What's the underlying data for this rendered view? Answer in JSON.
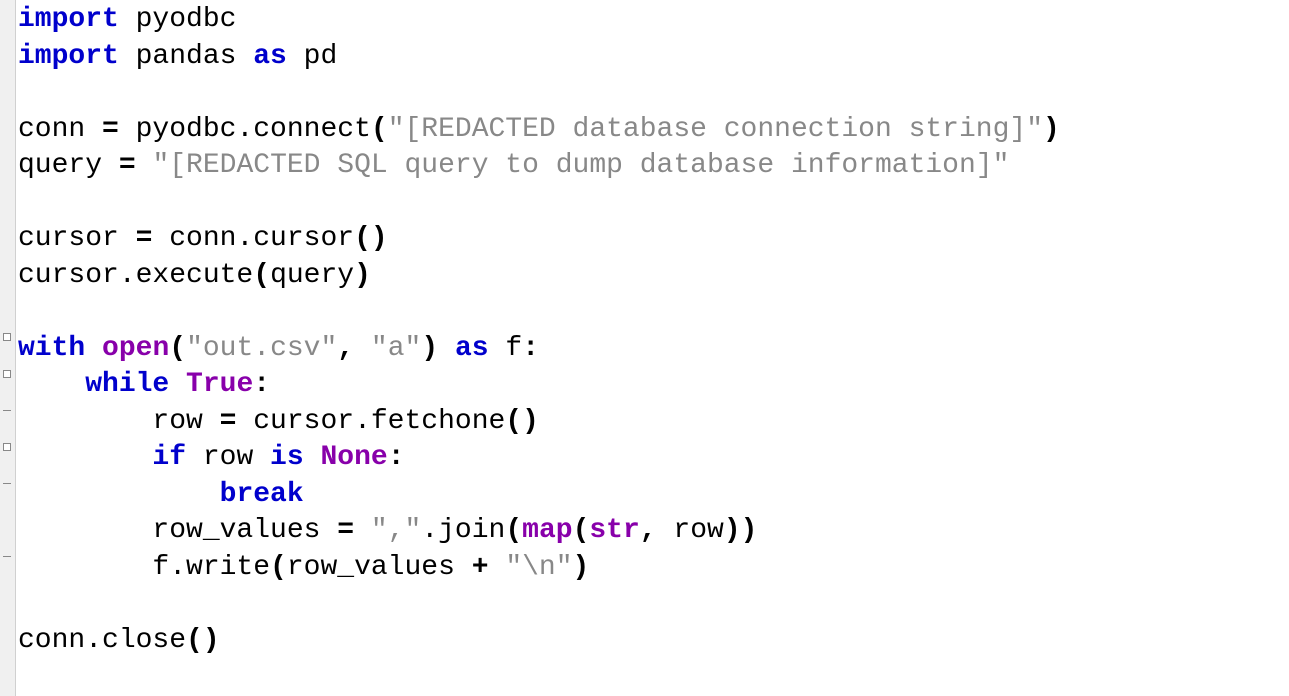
{
  "code": {
    "lines": [
      {
        "segments": [
          {
            "cls": "kw",
            "text": "import"
          },
          {
            "cls": "id",
            "text": " pyodbc"
          }
        ]
      },
      {
        "segments": [
          {
            "cls": "kw",
            "text": "import"
          },
          {
            "cls": "id",
            "text": " pandas "
          },
          {
            "cls": "kw",
            "text": "as"
          },
          {
            "cls": "id",
            "text": " pd"
          }
        ]
      },
      {
        "segments": [
          {
            "cls": "id",
            "text": ""
          }
        ]
      },
      {
        "segments": [
          {
            "cls": "id",
            "text": "conn "
          },
          {
            "cls": "op",
            "text": "="
          },
          {
            "cls": "id",
            "text": " pyodbc.connect"
          },
          {
            "cls": "punc",
            "text": "("
          },
          {
            "cls": "str",
            "text": "\"[REDACTED database connection string]\""
          },
          {
            "cls": "punc",
            "text": ")"
          }
        ]
      },
      {
        "segments": [
          {
            "cls": "id",
            "text": "query "
          },
          {
            "cls": "op",
            "text": "="
          },
          {
            "cls": "id",
            "text": " "
          },
          {
            "cls": "str",
            "text": "\"[REDACTED SQL query to dump database information]\""
          }
        ]
      },
      {
        "segments": [
          {
            "cls": "id",
            "text": ""
          }
        ]
      },
      {
        "segments": [
          {
            "cls": "id",
            "text": "cursor "
          },
          {
            "cls": "op",
            "text": "="
          },
          {
            "cls": "id",
            "text": " conn.cursor"
          },
          {
            "cls": "punc",
            "text": "()"
          }
        ]
      },
      {
        "segments": [
          {
            "cls": "id",
            "text": "cursor.execute"
          },
          {
            "cls": "punc",
            "text": "("
          },
          {
            "cls": "id",
            "text": "query"
          },
          {
            "cls": "punc",
            "text": ")"
          }
        ]
      },
      {
        "segments": [
          {
            "cls": "id",
            "text": ""
          }
        ]
      },
      {
        "segments": [
          {
            "cls": "kw",
            "text": "with"
          },
          {
            "cls": "id",
            "text": " "
          },
          {
            "cls": "kw2",
            "text": "open"
          },
          {
            "cls": "punc",
            "text": "("
          },
          {
            "cls": "str",
            "text": "\"out.csv\""
          },
          {
            "cls": "punc",
            "text": ","
          },
          {
            "cls": "id",
            "text": " "
          },
          {
            "cls": "str",
            "text": "\"a\""
          },
          {
            "cls": "punc",
            "text": ")"
          },
          {
            "cls": "id",
            "text": " "
          },
          {
            "cls": "kw",
            "text": "as"
          },
          {
            "cls": "id",
            "text": " f"
          },
          {
            "cls": "punc",
            "text": ":"
          }
        ]
      },
      {
        "segments": [
          {
            "cls": "id",
            "text": "    "
          },
          {
            "cls": "kw",
            "text": "while"
          },
          {
            "cls": "id",
            "text": " "
          },
          {
            "cls": "kw2",
            "text": "True"
          },
          {
            "cls": "punc",
            "text": ":"
          }
        ]
      },
      {
        "segments": [
          {
            "cls": "id",
            "text": "        row "
          },
          {
            "cls": "op",
            "text": "="
          },
          {
            "cls": "id",
            "text": " cursor.fetchone"
          },
          {
            "cls": "punc",
            "text": "()"
          }
        ]
      },
      {
        "segments": [
          {
            "cls": "id",
            "text": "        "
          },
          {
            "cls": "kw",
            "text": "if"
          },
          {
            "cls": "id",
            "text": " row "
          },
          {
            "cls": "kw",
            "text": "is"
          },
          {
            "cls": "id",
            "text": " "
          },
          {
            "cls": "kw2",
            "text": "None"
          },
          {
            "cls": "punc",
            "text": ":"
          }
        ]
      },
      {
        "segments": [
          {
            "cls": "id",
            "text": "            "
          },
          {
            "cls": "kw",
            "text": "break"
          }
        ]
      },
      {
        "segments": [
          {
            "cls": "id",
            "text": "        row_values "
          },
          {
            "cls": "op",
            "text": "="
          },
          {
            "cls": "id",
            "text": " "
          },
          {
            "cls": "str",
            "text": "\",\""
          },
          {
            "cls": "id",
            "text": ".join"
          },
          {
            "cls": "punc",
            "text": "("
          },
          {
            "cls": "kw2",
            "text": "map"
          },
          {
            "cls": "punc",
            "text": "("
          },
          {
            "cls": "kw2",
            "text": "str"
          },
          {
            "cls": "punc",
            "text": ","
          },
          {
            "cls": "id",
            "text": " row"
          },
          {
            "cls": "punc",
            "text": "))"
          }
        ]
      },
      {
        "segments": [
          {
            "cls": "id",
            "text": "        f.write"
          },
          {
            "cls": "punc",
            "text": "("
          },
          {
            "cls": "id",
            "text": "row_values "
          },
          {
            "cls": "op",
            "text": "+"
          },
          {
            "cls": "id",
            "text": " "
          },
          {
            "cls": "str",
            "text": "\"\\n\""
          },
          {
            "cls": "punc",
            "text": ")"
          }
        ]
      },
      {
        "segments": [
          {
            "cls": "id",
            "text": ""
          }
        ]
      },
      {
        "segments": [
          {
            "cls": "id",
            "text": "conn.close"
          },
          {
            "cls": "punc",
            "text": "()"
          }
        ]
      }
    ]
  }
}
